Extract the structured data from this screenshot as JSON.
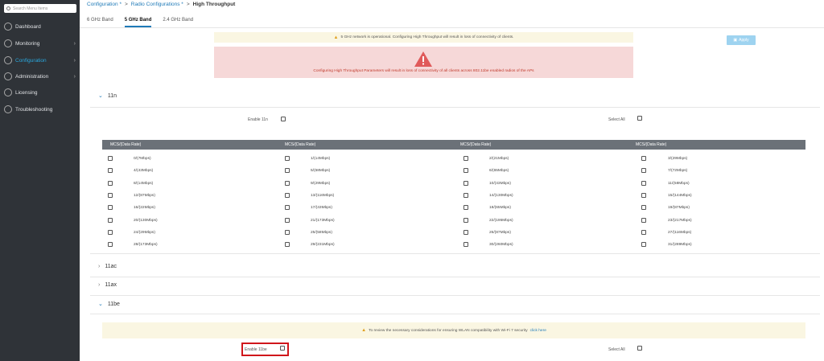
{
  "sidebar": {
    "search_placeholder": "Search Menu Items",
    "items": [
      {
        "label": "Dashboard",
        "icon": "dashboard-icon"
      },
      {
        "label": "Monitoring",
        "icon": "monitoring-icon"
      },
      {
        "label": "Configuration",
        "icon": "configuration-icon"
      },
      {
        "label": "Administration",
        "icon": "administration-icon"
      },
      {
        "label": "Licensing",
        "icon": "licensing-icon"
      },
      {
        "label": "Troubleshooting",
        "icon": "troubleshooting-icon"
      }
    ],
    "active_item": "Configuration"
  },
  "breadcrumb": {
    "items": [
      "Configuration *",
      "Radio Configurations *"
    ],
    "current": "High Throughput"
  },
  "tabs": [
    "6 GHz Band",
    "5 GHz Band",
    "2.4 GHz Band"
  ],
  "active_tab": "5 GHz Band",
  "apply_button": "Apply",
  "info_banner": "5 GHz network is operational. Configuring High Throughput will result in loss of connectivity of clients.",
  "error_banner": "Configuring High Throughput Parameters will result in loss of connectivity of all clients across 802.11be enabled radios of the APs",
  "sections": {
    "n11": {
      "title": "11n",
      "enable_label": "Enable 11n",
      "select_all_label": "Select All",
      "column_header": "MCS/(Data Rate)",
      "rows": [
        [
          "0/(7Mbps)",
          "1/(14Mbps)",
          "2/(21Mbps)",
          "3/(29Mbps)"
        ],
        [
          "4/(43Mbps)",
          "5/(58Mbps)",
          "6/(65Mbps)",
          "7/(72Mbps)"
        ],
        [
          "8/(14Mbps)",
          "9/(29Mbps)",
          "10/(43Mbps)",
          "11/(58Mbps)"
        ],
        [
          "12/(87Mbps)",
          "13/(116Mbps)",
          "14/(130Mbps)",
          "15/(144Mbps)"
        ],
        [
          "16/(22Mbps)",
          "17/(43Mbps)",
          "18/(65Mbps)",
          "19/(87Mbps)"
        ],
        [
          "20/(130Mbps)",
          "21/(173Mbps)",
          "22/(195Mbps)",
          "23/(217Mbps)"
        ],
        [
          "24/(29Mbps)",
          "25/(58Mbps)",
          "26/(87Mbps)",
          "27/(116Mbps)"
        ],
        [
          "28/(173Mbps)",
          "29/(231Mbps)",
          "30/(260Mbps)",
          "31/(289Mbps)"
        ]
      ]
    },
    "ac11": {
      "title": "11ac"
    },
    "ax11": {
      "title": "11ax"
    },
    "be11": {
      "title": "11be",
      "banner_text": "To review the necessary considerations for ensuring WLAN compatibility with Wi-Fi 7 security",
      "banner_link": "click here",
      "enable_label": "Enable 11be",
      "select_all_label": "Select All"
    }
  },
  "colors": {
    "sidebar_bg": "#2f3338",
    "accent": "#1f7ab8",
    "active_nav": "#2aa8de",
    "error_bg": "#f6d8d8",
    "warning_bg": "#faf6e2",
    "highlight_box": "#d0161b"
  }
}
